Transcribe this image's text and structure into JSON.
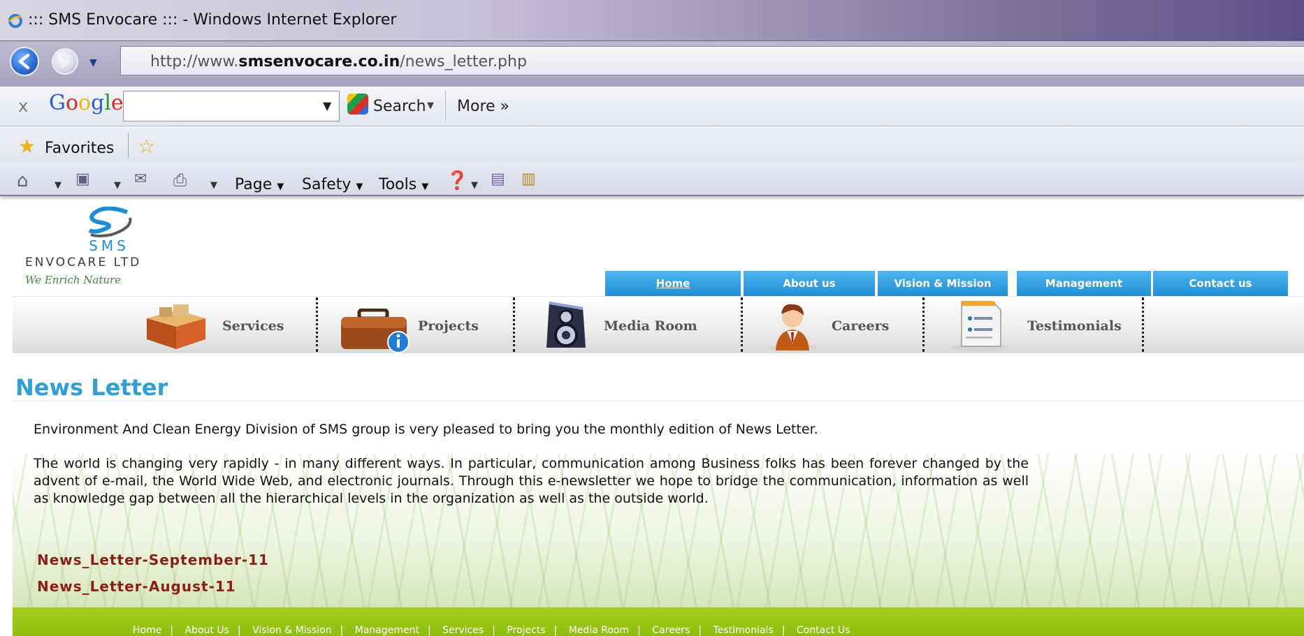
{
  "browser": {
    "window_title": "::: SMS Envocare ::: - Windows Internet Explorer",
    "url_prefix": "http://www.",
    "url_domain": "smsenvocare.co.in",
    "url_path": "/news_letter.php",
    "google_toolbar": {
      "close": "x",
      "logo": [
        "G",
        "o",
        "o",
        "g",
        "l",
        "e"
      ],
      "search_value": "",
      "search_label": "Search",
      "more_label": "More »"
    },
    "favorites_label": "Favorites",
    "command_menus": [
      "Page",
      "Safety",
      "Tools"
    ]
  },
  "site": {
    "logo": {
      "brand": "SMS",
      "company": "ENVOCARE LTD",
      "tagline": "We Enrich Nature"
    },
    "top_nav": [
      "Home",
      "About us",
      "Vision & Mission",
      "Management",
      "Contact us"
    ],
    "icon_nav": [
      {
        "label": "Services",
        "icon": "box-icon"
      },
      {
        "label": "Projects",
        "icon": "briefcase-icon"
      },
      {
        "label": "Media Room",
        "icon": "speaker-icon"
      },
      {
        "label": "Careers",
        "icon": "person-icon"
      },
      {
        "label": "Testimonials",
        "icon": "document-icon"
      }
    ],
    "page_title": "News Letter",
    "intro": "Environment And Clean Energy Division of SMS group is very pleased to bring you the monthly edition of News Letter.",
    "body": "The world is changing very rapidly - in many different ways. In particular, communication among Business folks has been forever changed by the advent of e-mail, the World Wide Web, and electronic journals. Through this e-newsletter we hope to bridge the communication, information as well as knowledge gap between all the hierarchical levels in the organization as well as the outside world.",
    "newsletters": [
      "News_Letter-September-11",
      "News_Letter-August-11"
    ],
    "footer_links": [
      "Home",
      "About Us",
      "Vision & Mission",
      "Management",
      "Services",
      "Projects",
      "Media Room",
      "Careers",
      "Testimonials",
      "Contact Us"
    ],
    "colors": {
      "accent_blue": "#2e9fd9",
      "link_red": "#8a1f17",
      "footer_green": "#9cc81a"
    }
  }
}
